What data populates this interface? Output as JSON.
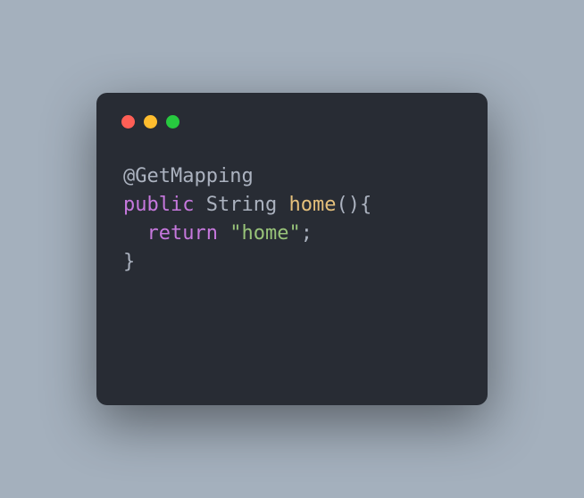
{
  "code": {
    "line1": {
      "annotation": "@GetMapping"
    },
    "line2": {
      "keyword": "public",
      "space1": " ",
      "type": "String",
      "space2": " ",
      "method": "home",
      "parens_brace": "(){"
    },
    "line3": {
      "indent": "  ",
      "keyword": "return",
      "space": " ",
      "string": "\"home\"",
      "semi": ";"
    },
    "line4": {
      "brace": "}"
    }
  }
}
